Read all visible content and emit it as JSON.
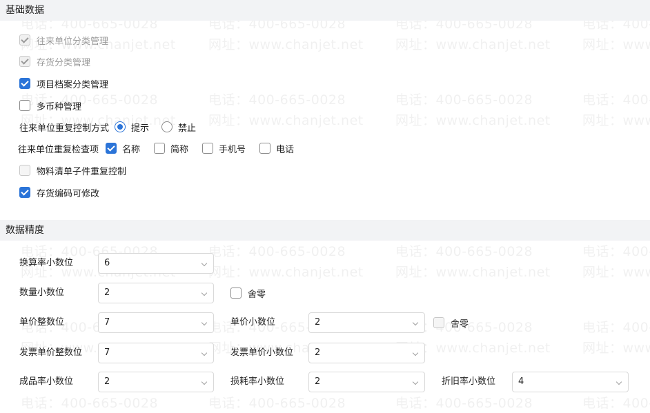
{
  "basic": {
    "title": "基础数据",
    "partner_category": "往来单位分类管理",
    "inventory_category": "存货分类管理",
    "project_category": "项目档案分类管理",
    "multi_currency": "多币种管理",
    "dup_control_label": "往来单位重复控制方式",
    "dup_control_options": [
      "提示",
      "禁止"
    ],
    "dup_check_label": "往来单位重复检查项",
    "dup_check_items": [
      "名称",
      "简称",
      "手机号",
      "电话"
    ],
    "bom_dup_control": "物料清单子件重复控制",
    "inventory_code_editable": "存货编码可修改"
  },
  "precision": {
    "title": "数据精度",
    "conversion_rate_label": "换算率小数位",
    "conversion_rate_value": "6",
    "quantity_label": "数量小数位",
    "quantity_value": "2",
    "quantity_round_label": "舍零",
    "unit_price_int_label": "单价整数位",
    "unit_price_int_value": "7",
    "unit_price_dec_label": "单价小数位",
    "unit_price_dec_value": "2",
    "unit_price_round_label": "舍零",
    "invoice_price_int_label": "发票单价整数位",
    "invoice_price_int_value": "7",
    "invoice_price_dec_label": "发票单价小数位",
    "invoice_price_dec_value": "2",
    "yield_rate_label": "成品率小数位",
    "yield_rate_value": "2",
    "loss_rate_label": "损耗率小数位",
    "loss_rate_value": "2",
    "depreciation_rate_label": "折旧率小数位",
    "depreciation_rate_value": "4"
  },
  "watermark": {
    "phone": "电话：400-665-0028",
    "site": "网址：www.chanjet.net"
  },
  "colors": {
    "accent": "#2b74d8",
    "section_bg": "#f2f3f5"
  }
}
